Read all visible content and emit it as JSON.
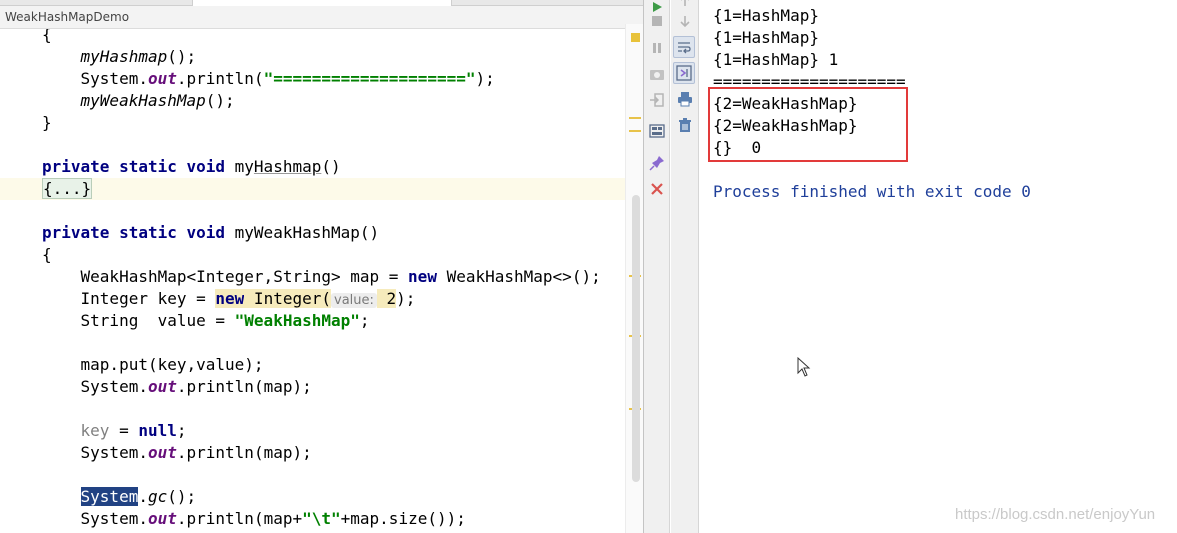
{
  "editor": {
    "breadcrumb": "WeakHashMapDemo",
    "lines": [
      {
        "segments": [
          {
            "t": "{"
          }
        ]
      },
      {
        "segments": [
          {
            "t": "    "
          },
          {
            "t": "myHashmap",
            "c": "it"
          },
          {
            "t": "();"
          }
        ]
      },
      {
        "segments": [
          {
            "t": "    System."
          },
          {
            "t": "out",
            "c": "fld"
          },
          {
            "t": ".println("
          },
          {
            "t": "\"====================\"",
            "c": "str"
          },
          {
            "t": ");"
          }
        ]
      },
      {
        "segments": [
          {
            "t": "    "
          },
          {
            "t": "myWeakHashMap",
            "c": "it"
          },
          {
            "t": "();"
          }
        ]
      },
      {
        "segments": [
          {
            "t": "}"
          }
        ]
      },
      {
        "segments": []
      },
      {
        "segments": [
          {
            "t": "private static void ",
            "c": "kw"
          },
          {
            "t": "my"
          },
          {
            "t": "Hashmap",
            "c": "uline"
          },
          {
            "t": "()"
          }
        ]
      },
      {
        "highlight": true,
        "segments": [
          {
            "t": "{...}",
            "c": "fold"
          }
        ]
      },
      {
        "segments": []
      },
      {
        "segments": [
          {
            "t": "private static void ",
            "c": "kw"
          },
          {
            "t": "myWeakHashMap()"
          }
        ]
      },
      {
        "segments": [
          {
            "t": "{"
          }
        ]
      },
      {
        "segments": [
          {
            "t": "    WeakHashMap<Integer,String> map = "
          },
          {
            "t": "new",
            "c": "kw"
          },
          {
            "t": " WeakHashMap<>();"
          }
        ]
      },
      {
        "segments": [
          {
            "t": "    Integer key = "
          },
          {
            "t": "new",
            "c": "kw newbg"
          },
          {
            "t": " Integer(",
            "c": "newbg"
          },
          {
            "t": "value:",
            "c": "hint"
          },
          {
            "t": " 2",
            "c": "newbg"
          },
          {
            "t": ");"
          }
        ]
      },
      {
        "segments": [
          {
            "t": "    String  value = "
          },
          {
            "t": "\"WeakHashMap\"",
            "c": "str"
          },
          {
            "t": ";"
          }
        ]
      },
      {
        "segments": []
      },
      {
        "segments": [
          {
            "t": "    map.put(key,value);"
          }
        ]
      },
      {
        "segments": [
          {
            "t": "    System."
          },
          {
            "t": "out",
            "c": "fld"
          },
          {
            "t": ".println(map);"
          }
        ]
      },
      {
        "segments": []
      },
      {
        "segments": [
          {
            "t": "    "
          },
          {
            "t": "key",
            "c": "gray"
          },
          {
            "t": " = "
          },
          {
            "t": "null",
            "c": "kw"
          },
          {
            "t": ";"
          }
        ]
      },
      {
        "segments": [
          {
            "t": "    System."
          },
          {
            "t": "out",
            "c": "fld"
          },
          {
            "t": ".println(map);"
          }
        ]
      },
      {
        "segments": []
      },
      {
        "segments": [
          {
            "t": "    "
          },
          {
            "t": "System",
            "c": "sel"
          },
          {
            "t": "."
          },
          {
            "t": "gc",
            "c": "it"
          },
          {
            "t": "();"
          }
        ]
      },
      {
        "segments": [
          {
            "t": "    System."
          },
          {
            "t": "out",
            "c": "fld"
          },
          {
            "t": ".println(map+"
          },
          {
            "t": "\"\\t\"",
            "c": "str"
          },
          {
            "t": "+map.size());"
          }
        ]
      }
    ]
  },
  "console": {
    "lines": [
      "{1=HashMap}",
      "{1=HashMap}",
      "{1=HashMap} 1",
      "====================",
      "{2=WeakHashMap}",
      "{2=WeakHashMap}",
      "{}  0",
      "",
      "Process finished with exit code 0"
    ]
  },
  "watermark": "https://blog.csdn.net/enjoyYun",
  "colors": {
    "keyword": "#000080",
    "string": "#008000",
    "field": "#660e7a",
    "console_blue": "#1f3f9a",
    "highlight_box": "#e23a3a"
  },
  "toolbar": {
    "left_icons": [
      "rerun-icon",
      "stop-icon",
      "pause-icon",
      "camera-icon",
      "exit-icon",
      "layout-icon",
      "pin-icon",
      "close-icon"
    ],
    "right_icons": [
      "up-arrow-icon",
      "down-arrow-icon",
      "soft-wrap-icon",
      "scroll-to-end-icon",
      "print-icon",
      "trash-icon"
    ]
  }
}
